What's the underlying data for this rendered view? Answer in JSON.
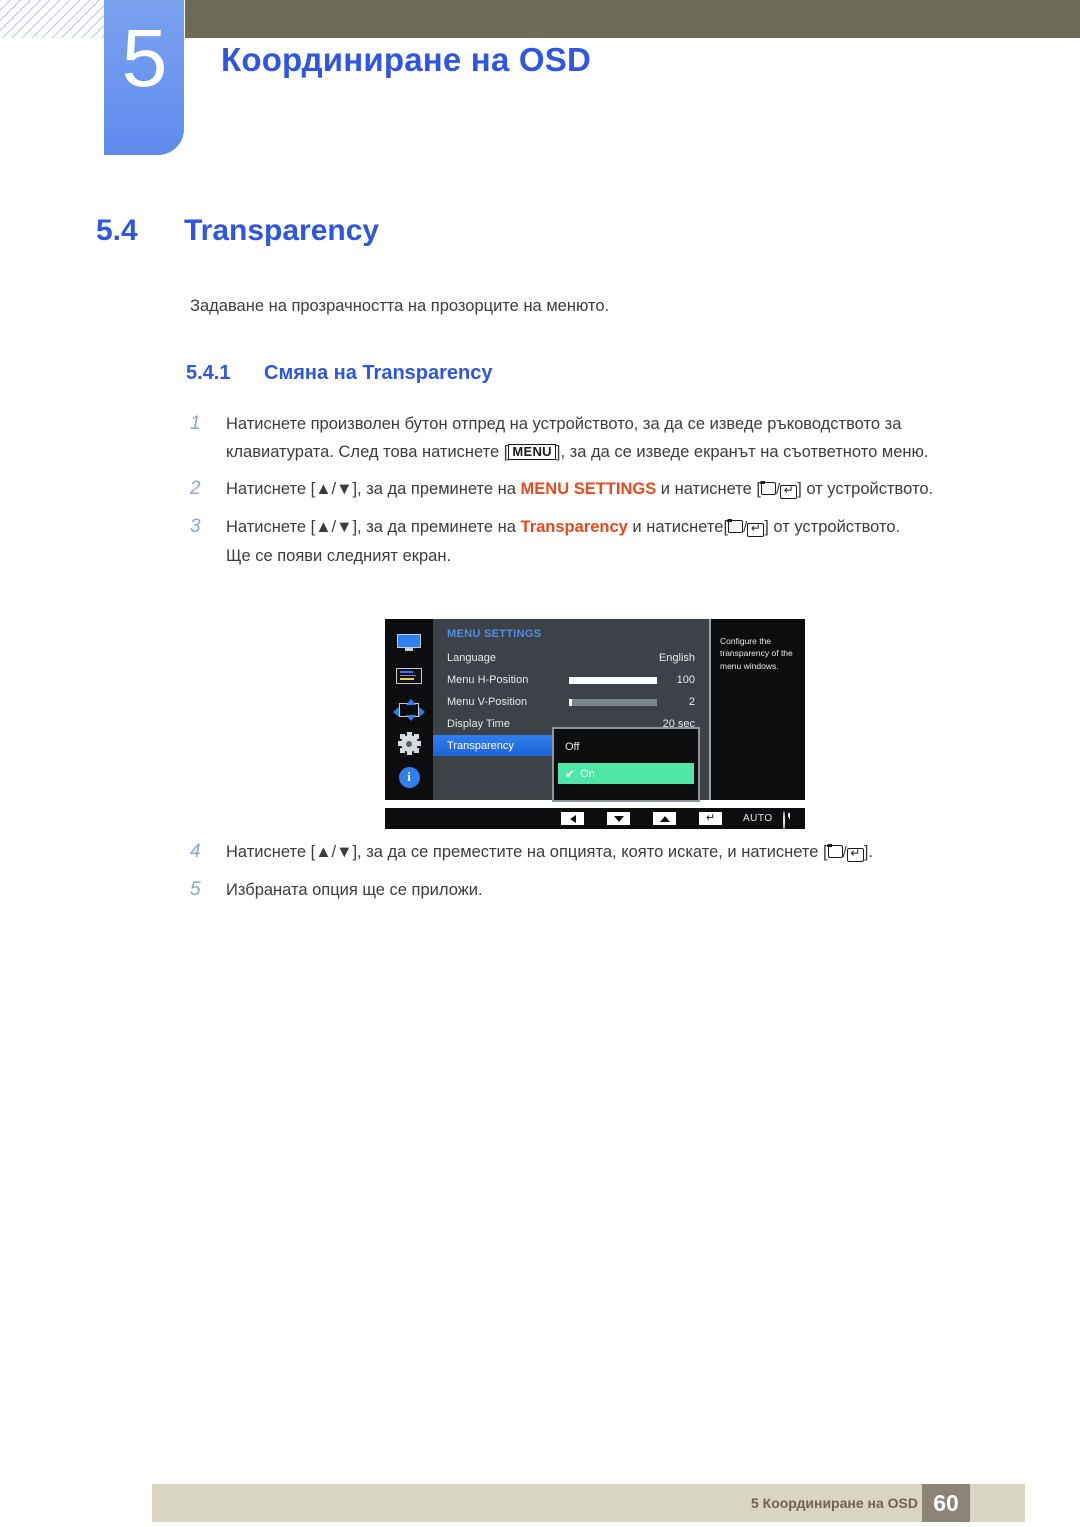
{
  "header": {
    "chapter_number": "5",
    "chapter_title": "Координиране на OSD",
    "accent_blue": "#2f55e3",
    "olive": "#6d6b58"
  },
  "section": {
    "number": "5.4",
    "title": "Transparency",
    "intro": "Задаване на прозрачността на прозорците на менюто.",
    "subsection_number": "5.4.1",
    "subsection_title": "Смяна на Transparency"
  },
  "steps": [
    {
      "num": "1",
      "part1": "Натиснете произволен бутон отпред на устройството, за да се изведе ръководството за клавиатурата. След това натиснете [",
      "key": "MENU",
      "part2": "], за да се изведе екранът на съответното меню."
    },
    {
      "num": "2",
      "part1": "Натиснете [▲/▼], за да преминете на ",
      "highlight": "MENU SETTINGS",
      "part2": " и натиснете [",
      "part3": "] от устройството."
    },
    {
      "num": "3",
      "part1": "Натиснете [▲/▼], за да преминете на ",
      "highlight": "Transparency",
      "part2": " и натиснете[",
      "part3": "] от устройството.",
      "note": "Ще се появи следният екран."
    },
    {
      "num": "4",
      "part1": "Натиснете [▲/▼], за да се преместите на опцията, която искате, и натиснете [",
      "part3": "]."
    },
    {
      "num": "5",
      "part1": "Избраната опция ще се приложи."
    }
  ],
  "osd": {
    "category": "MENU SETTINGS",
    "rows": [
      {
        "label": "Language",
        "value": "English",
        "slider": null
      },
      {
        "label": "Menu H-Position",
        "value": "100",
        "slider": 100
      },
      {
        "label": "Menu V-Position",
        "value": "2",
        "slider": 2
      },
      {
        "label": "Display Time",
        "value": "20 sec",
        "slider": null
      },
      {
        "label": "Transparency",
        "value": "",
        "slider": null,
        "selected": true
      }
    ],
    "help_text": "Configure the transparency of the menu windows.",
    "dropdown": {
      "options": [
        "Off",
        "On"
      ],
      "selected": "On",
      "check_glyph": "✔"
    },
    "bottom_bar": {
      "auto_label": "AUTO",
      "keys": [
        "left-triangle",
        "down-triangle",
        "up-triangle",
        "enter-arrow"
      ]
    },
    "colors": {
      "highlight_blue": "#2f7ff0",
      "option_green": "#4fe7a6",
      "panel_gray": "#3c4247",
      "rail_black": "#0d0d0f"
    }
  },
  "footer": {
    "text": "5 Координиране на OSD",
    "page": "60",
    "bar_color": "#d9d5c3",
    "page_box_color": "#8d8375"
  }
}
